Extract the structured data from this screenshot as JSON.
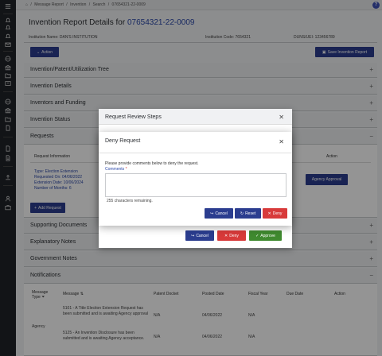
{
  "breadcrumb": [
    "Message Report",
    "Invention",
    "Search",
    "07654321-22-0009"
  ],
  "header": {
    "title_prefix": "Invention Report Details for",
    "invention_number": "07654321-22-0009"
  },
  "institution": {
    "name_label": "Institution Name:",
    "name_value": "DAN'S INSTITUTION",
    "code_label": "Institution Code:",
    "code_value": "7654321",
    "duns_label": "DUNS/UEI:",
    "duns_value": "123456789"
  },
  "toolbar": {
    "action_label": "Action",
    "save_label": "Save Invention Report"
  },
  "sections": {
    "tree": "Invention/Patent/Utilization Tree",
    "details": "Invention Details",
    "inventors": "Inventors and Funding",
    "status": "Invention Status",
    "requests": "Requests",
    "supporting": "Supporting Documents",
    "explanatory": "Explanatory Notes",
    "government": "Government Notes",
    "notifications": "Notifications"
  },
  "requests": {
    "col_info": "Request Information",
    "col_action": "Action",
    "type": "Type: Election Extension",
    "requested_on": "Requested On: 04/06/2022",
    "extension_date": "Extension Date: 10/06/2024",
    "months": "Number of Months: 6",
    "agency_approval": "Agency Approval",
    "add_request": "Add Request"
  },
  "notifications": {
    "columns": [
      "Message Type",
      "Message",
      "Patent Docket",
      "Posted Date",
      "Fiscal Year",
      "Due Date",
      "Action"
    ],
    "message_type": "Agency",
    "rows": [
      {
        "message": "5101 - A Title Election Extension Request has been submitted and is awaiting Agency approval",
        "patent_docket": "N/A",
        "posted_date": "04/06/2022",
        "fiscal_year": "N/A"
      },
      {
        "message": "5125 - An Invention Disclosure has been submitted and is awaiting Agency acceptance.",
        "patent_docket": "N/A",
        "posted_date": "04/06/2022",
        "fiscal_year": "N/A"
      }
    ]
  },
  "review_modal": {
    "title": "Request Review Steps",
    "cancel": "Cancel",
    "deny": "Deny",
    "approve": "Approve"
  },
  "deny_modal": {
    "title": "Deny Request",
    "prompt": "Please provide comments below to deny the request.",
    "comments_label": "Comments",
    "required_mark": "*",
    "remaining": "255 characters remaining.",
    "cancel": "Cancel",
    "reset": "Reset",
    "deny": "Deny"
  },
  "colors": {
    "primary": "#2b3d8f",
    "danger": "#d83a3a",
    "success": "#3f8a2f",
    "sidebar": "#1f2329"
  }
}
